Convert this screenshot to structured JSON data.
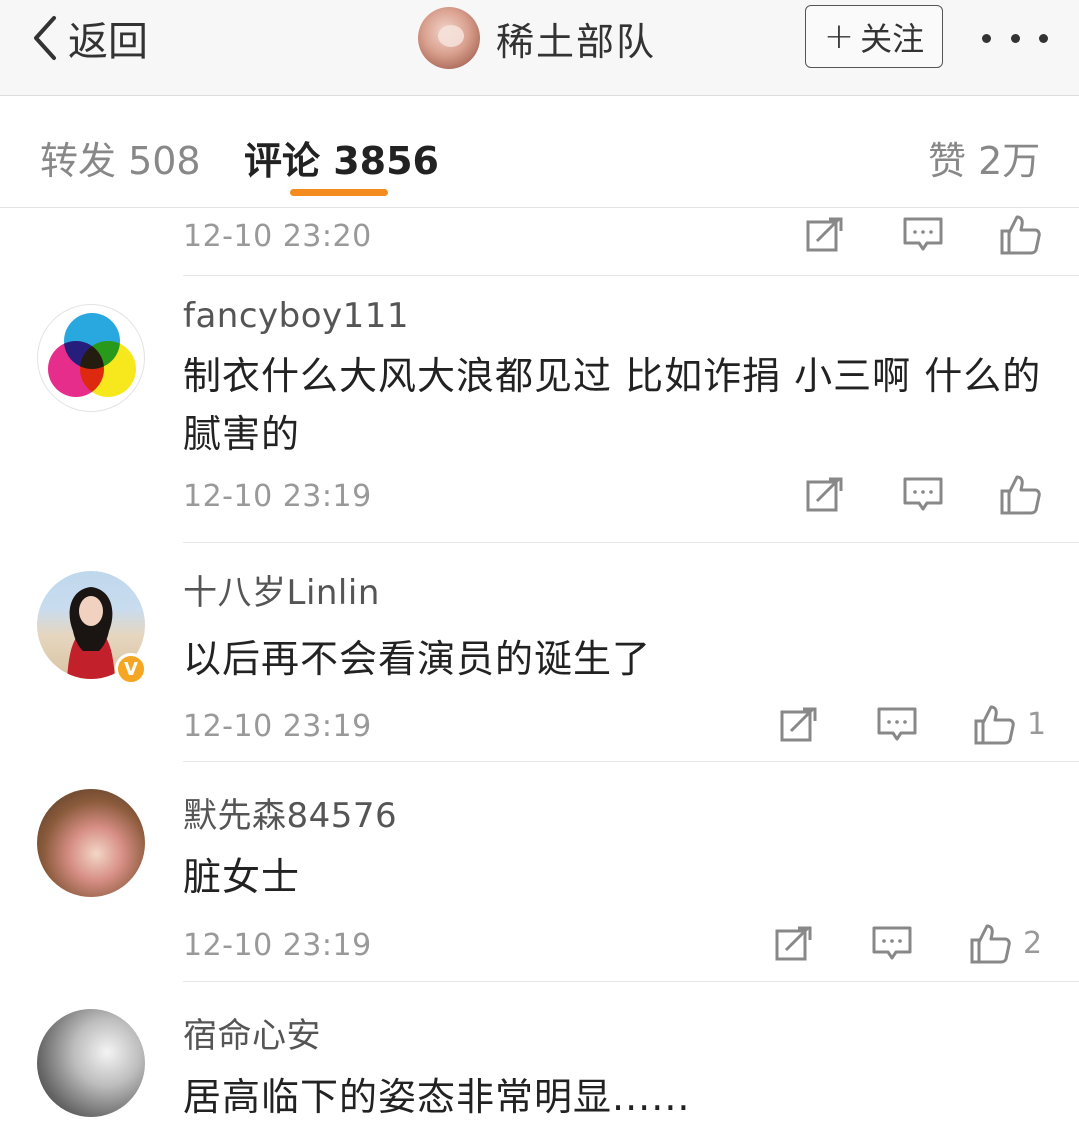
{
  "navbar": {
    "back_label": "返回",
    "title": "稀土部队",
    "follow_label": "关注",
    "follow_plus": "+"
  },
  "tabs": {
    "repost": "转发 508",
    "comment": "评论 3856",
    "like": "赞 2万"
  },
  "colors": {
    "accent": "#f38b1e",
    "verified": "#f5a623"
  },
  "icons": {
    "back": "chevron-left-icon",
    "more": "more-dots-icon",
    "repost": "repost-icon",
    "reply": "comment-icon",
    "like": "thumbs-up-icon"
  },
  "comments": [
    {
      "time": "12-10 23:20",
      "likes": ""
    },
    {
      "username": "fancyboy111",
      "text": "制衣什么大风大浪都见过  比如诈捐  小三啊  什么的  腻害的",
      "time": "12-10 23:19",
      "likes": ""
    },
    {
      "username": "十八岁Linlin",
      "text": "以后再不会看演员的诞生了",
      "time": "12-10 23:19",
      "likes": "1",
      "verified": "V"
    },
    {
      "username": "默先森84576",
      "text": "脏女士",
      "time": "12-10 23:19",
      "likes": "2"
    },
    {
      "username": "宿命心安",
      "text": "居高临下的姿态非常明显......"
    }
  ]
}
